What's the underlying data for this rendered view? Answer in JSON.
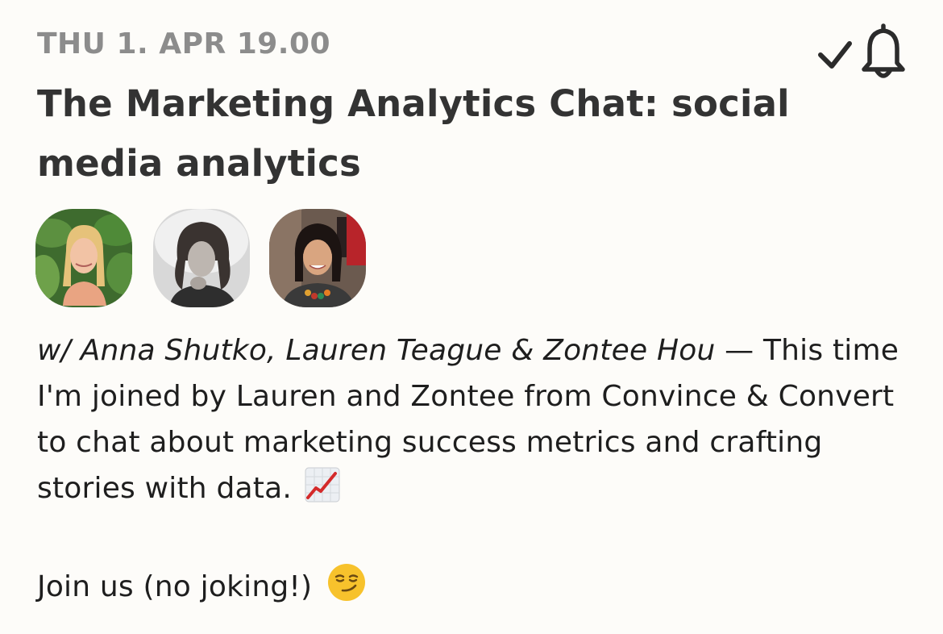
{
  "event": {
    "date_label": "THU 1. APR 19.00",
    "title": "The Marketing Analytics Chat: social media analytics",
    "hosts_prefix": "w/ Anna Shutko, Lauren Teague & Zontee Hou",
    "description": " — This time I'm joined by Lauren and Zontee from Convince & Convert to chat about marketing success metrics and crafting stories with data.",
    "join_text": "Join us (no joking!)",
    "description_emoji": "chart-increasing-icon",
    "join_emoji": "smirking-face-icon"
  },
  "actions": {
    "attending": "check-icon",
    "notify": "bell-icon"
  },
  "speakers": [
    {
      "name": "Anna Shutko"
    },
    {
      "name": "Lauren Teague"
    },
    {
      "name": "Zontee Hou"
    }
  ],
  "colors": {
    "date": "#8c8c8c",
    "title": "#333333",
    "body": "#1e1e1e",
    "background": "#fdfcf9"
  }
}
